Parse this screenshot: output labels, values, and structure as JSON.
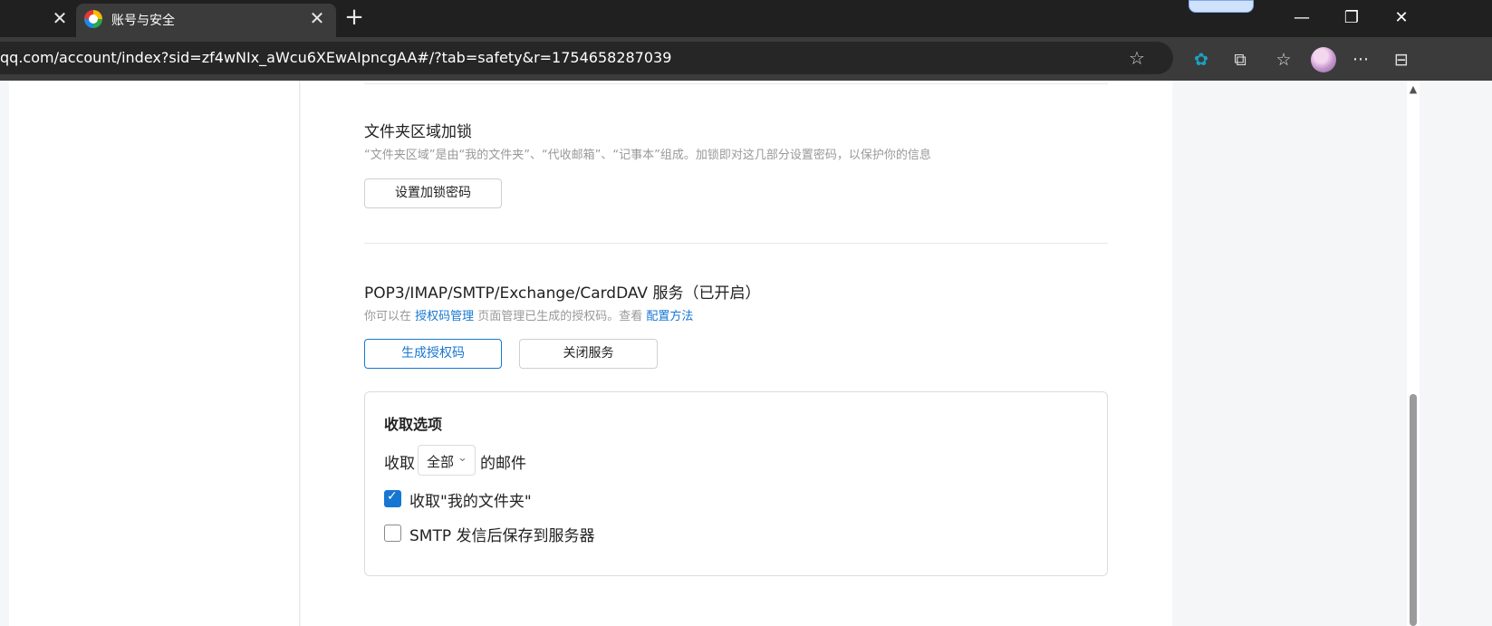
{
  "browser": {
    "tab_title": "账号与安全",
    "tab_close_glyph": "✕",
    "new_tab_glyph": "+",
    "url": "qq.com/account/index?sid=zf4wNIx_aWcu6XEwAIpncgAA#/?tab=safety&r=1754658287039",
    "minimize_glyph": "—",
    "restore_glyph": "❐",
    "close_glyph": "✕",
    "star_glyph": "☆",
    "toolbar_icons": {
      "settings_glyph": "✿",
      "extensions_glyph": "⧉",
      "favorites_glyph": "☆",
      "more_glyph": "···",
      "sidebar_glyph": "⊟"
    }
  },
  "folder_lock": {
    "title": "文件夹区域加锁",
    "description": "“文件夹区域”是由“我的文件夹”、“代收邮箱”、“记事本”组成。加锁即对这几部分设置密码，以保护你的信息",
    "button": "设置加锁密码"
  },
  "pop3": {
    "title": "POP3/IMAP/SMTP/Exchange/CardDAV 服务（已开启）",
    "desc_prefix": "你可以在 ",
    "desc_link1": "授权码管理",
    "desc_middle": " 页面管理已生成的授权码。查看 ",
    "desc_link2": "配置方法",
    "button_generate": "生成授权码",
    "button_close": "关闭服务"
  },
  "receive_options": {
    "title": "收取选项",
    "receive_prefix": "收取",
    "select_value": "全部",
    "select_caret": "⌄",
    "receive_suffix": "的邮件",
    "option_my_folder": {
      "label": "收取\"我的文件夹\"",
      "checked": true,
      "checkmark": "✓"
    },
    "option_smtp_save": {
      "label": "SMTP 发信后保存到服务器",
      "checked": false
    }
  },
  "scrollbar": {
    "up_arrow": "▲"
  },
  "colors": {
    "accent": "#1677d2",
    "chrome_dark": "#202020",
    "chrome_toolbar": "#3b3b3b"
  }
}
